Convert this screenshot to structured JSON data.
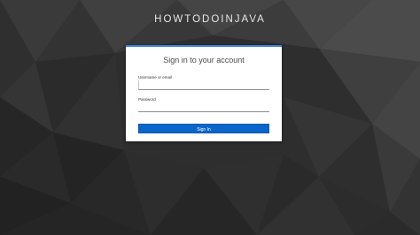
{
  "realm": {
    "title": "HOWTODOINJAVA"
  },
  "login_form": {
    "header": "Sign in to your account",
    "username_label": "Username or email",
    "username_value": "",
    "password_label": "Password",
    "password_value": "",
    "submit_label": "Sign In"
  },
  "colors": {
    "accent": "#0a66c8",
    "card_top_border": "#3b7fd0",
    "background": "#2c2c2c"
  }
}
